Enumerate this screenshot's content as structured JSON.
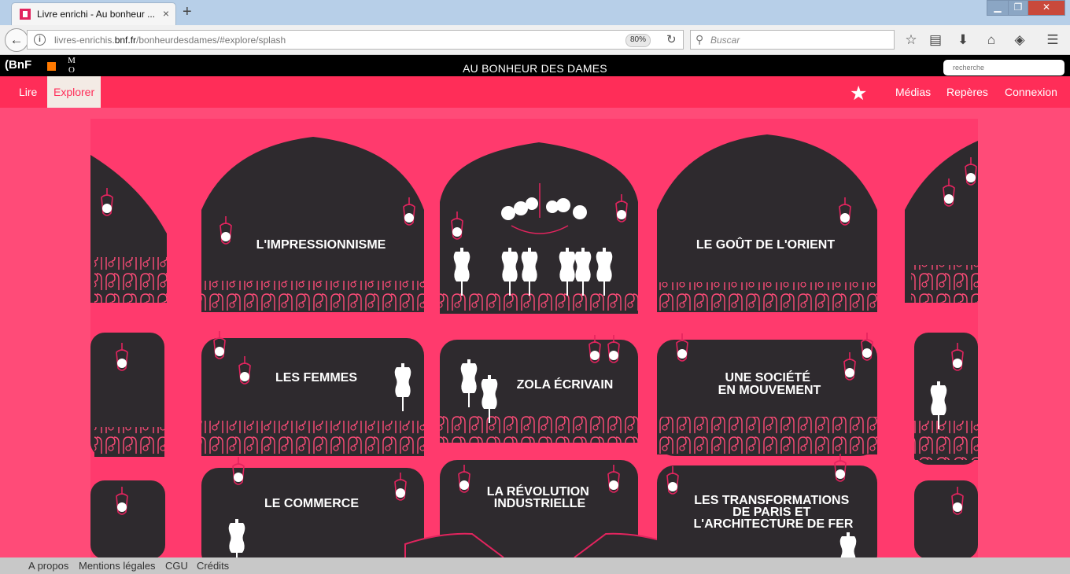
{
  "browser": {
    "tab_title": "Livre enrichi - Au bonheur ...",
    "tab_close": "×",
    "new_tab": "+",
    "url_prefix": "livres-enrichis.",
    "url_domain": "bnf.fr",
    "url_path": "/bonheurdesdames/#explore/splash",
    "zoom": "80%",
    "search_placeholder": "Buscar"
  },
  "header": {
    "bnf_logo": "(BnF",
    "mo_logo": "M O",
    "title": "AU BONHEUR DES DAMES",
    "search_placeholder": "recherche"
  },
  "nav": {
    "left": [
      "Lire",
      "Explorer"
    ],
    "active": "Explorer",
    "right": [
      "Médias",
      "Repères",
      "Connexion"
    ]
  },
  "themes": [
    "L'IMPRESSIONNISME",
    "LE GOÛT DE L'ORIENT",
    "LES FEMMES",
    "ZOLA ÉCRIVAIN",
    "UNE SOCIÉTÉ EN MOUVEMENT",
    "LE COMMERCE",
    "LA RÉVOLUTION INDUSTRIELLE",
    "LES TRANSFORMATIONS DE PARIS ET L'ARCHITECTURE DE FER"
  ],
  "footer": [
    "A propos",
    "Mentions légales",
    "CGU",
    "Crédits"
  ],
  "colors": {
    "brand_pink": "#ff2d58",
    "background_pink": "#ff4b78",
    "panel_dark": "#2e2a2e",
    "accent_magenta": "#e2245e"
  }
}
